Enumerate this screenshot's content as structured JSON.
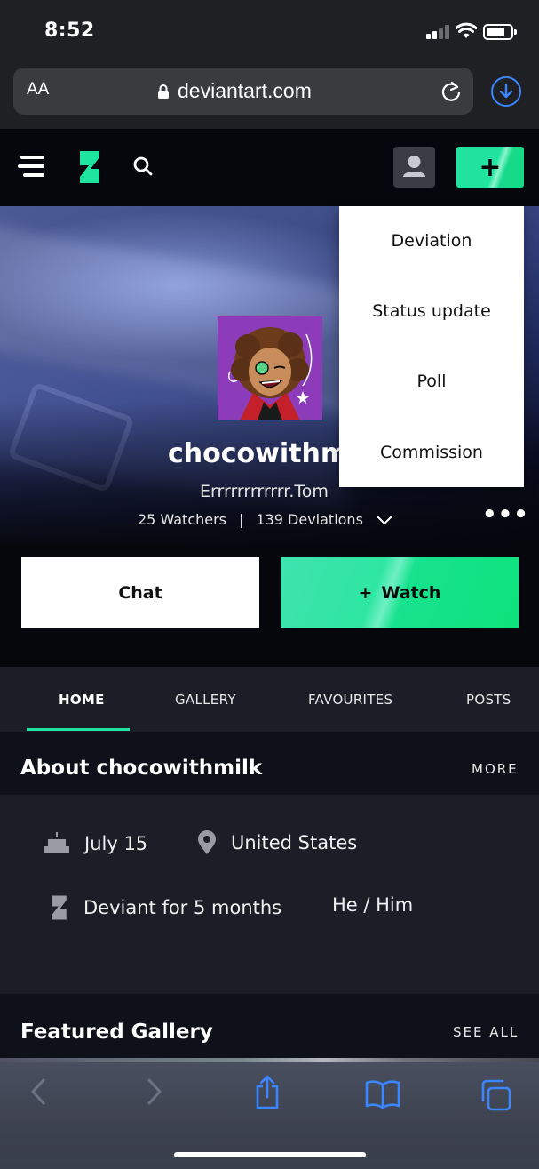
{
  "status_bar": {
    "time": "8:52"
  },
  "browser": {
    "text_size_label": "AA",
    "url": "deviantart.com"
  },
  "header": {
    "create_label": "+"
  },
  "create_menu": {
    "items": [
      {
        "label": "Deviation"
      },
      {
        "label": "Status update"
      },
      {
        "label": "Poll"
      },
      {
        "label": "Commission"
      }
    ]
  },
  "profile": {
    "username": "chocowithmi",
    "tagline": "Errrrrrrrrrrr.Tom",
    "watchers": "25 Watchers",
    "separator": "|",
    "deviations": "139 Deviations",
    "more": "•••"
  },
  "actions": {
    "chat_label": "Chat",
    "watch_plus": "+",
    "watch_label": "Watch"
  },
  "tabs": [
    {
      "label": "HOME",
      "active": true
    },
    {
      "label": "GALLERY",
      "active": false
    },
    {
      "label": "FAVOURITES",
      "active": false
    },
    {
      "label": "POSTS",
      "active": false
    }
  ],
  "about": {
    "title": "About chocowithmilk",
    "more_label": "MORE",
    "birthday": "July 15",
    "location": "United States",
    "deviant_since": "Deviant for 5 months",
    "pronouns": "He / Him"
  },
  "featured": {
    "title": "Featured Gallery",
    "see_all_label": "SEE ALL"
  },
  "colors": {
    "accent_green": "#1fe4a0",
    "ios_blue": "#3a86ff",
    "background": "#06070d",
    "panel": "#1b1e27"
  }
}
